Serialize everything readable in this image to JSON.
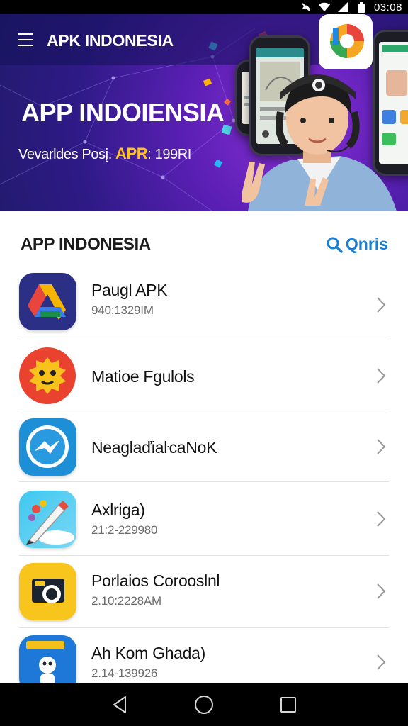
{
  "status_bar": {
    "time": "03:08"
  },
  "header": {
    "title": "APK INDONESIA",
    "menu_icon": "hamburger-menu-icon"
  },
  "hero": {
    "headline": "APP INDOIENSIA",
    "subline_prefix": "Vevarldes Posį.",
    "subline_highlight": "APR",
    "subline_suffix": ": 199RI",
    "highlight_color": "#ffc21a"
  },
  "section": {
    "title": "APP INDONESIA",
    "search_label": "Qnris"
  },
  "apps": [
    {
      "name": "Paugl APK",
      "meta": "940:1329IM",
      "icon": "drive-triangle-icon"
    },
    {
      "name": "Matioe Fgulols",
      "meta": "",
      "icon": "smiley-face-icon"
    },
    {
      "name": "NeaglaďiaŀcaNoK",
      "meta": "",
      "icon": "messenger-bolt-icon"
    },
    {
      "name": "Axlriga)",
      "meta": "21:2-229980",
      "icon": "pencil-brush-icon"
    },
    {
      "name": "Porlaios Corooslnl",
      "meta": "2.10:2228AM",
      "icon": "camera-card-icon"
    },
    {
      "name": "Ah Kom Ghada)",
      "meta": "2.14-139926",
      "icon": "robot-character-icon"
    }
  ],
  "colors": {
    "accent": "#1a7fd4",
    "hero_dark": "#221a6e",
    "hero_purple": "#8b2fd6"
  }
}
